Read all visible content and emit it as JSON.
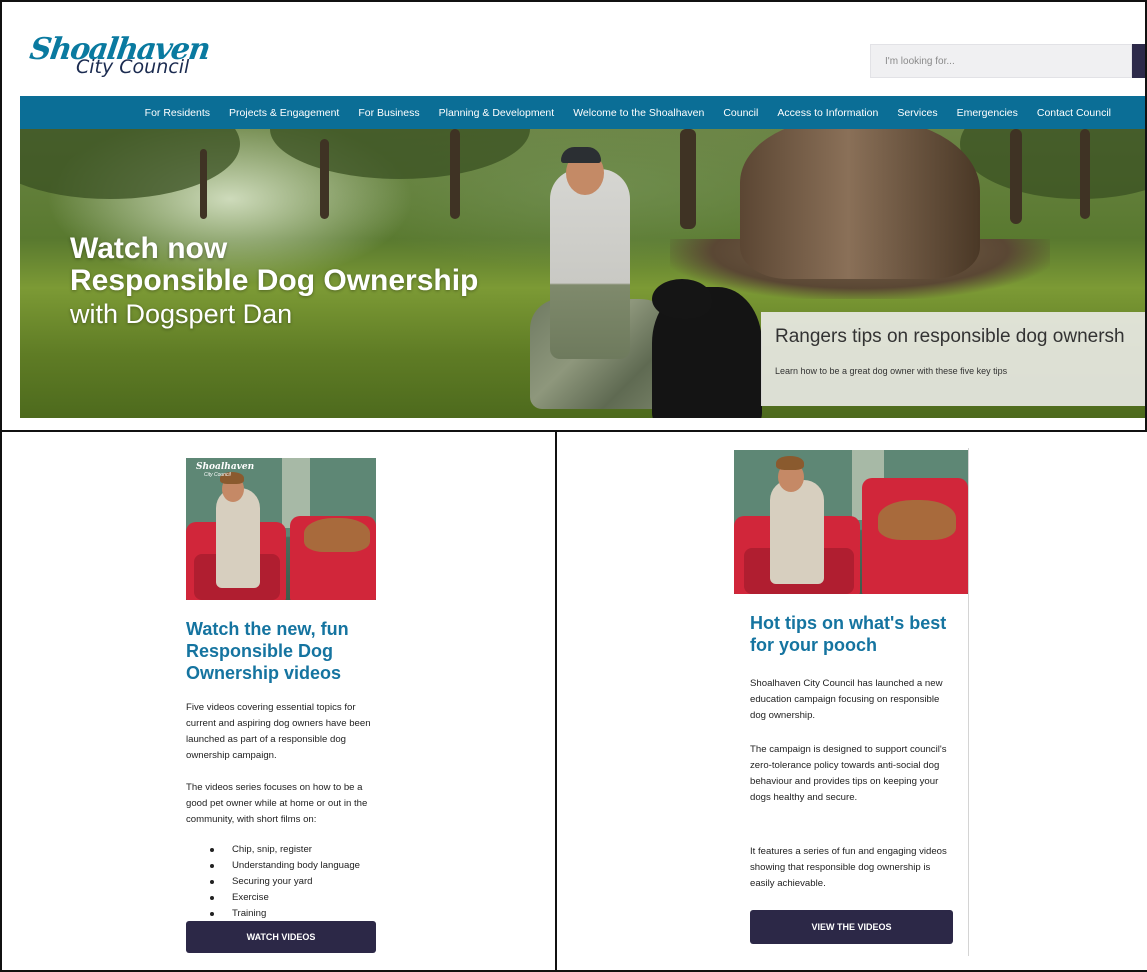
{
  "header": {
    "logo_script": "Shoalhaven",
    "logo_sub": "City Council",
    "search_placeholder": "I'm looking for..."
  },
  "nav": {
    "items": [
      "For Residents",
      "Projects & Engagement",
      "For Business",
      "Planning & Development",
      "Welcome to the Shoalhaven",
      "Council",
      "Access to Information",
      "Services",
      "Emergencies",
      "Contact Council"
    ]
  },
  "hero": {
    "line1": "Watch now",
    "line2": "Responsible Dog Ownership",
    "line3": "with Dogspert Dan",
    "card_title": "Rangers tips on responsible dog ownersh",
    "card_sub": "Learn how to be a great dog owner with these five key tips"
  },
  "left_card": {
    "thumb_logo": "Shoalhaven",
    "thumb_logo_sub": "City Council",
    "title": "Watch the new, fun Responsible Dog Ownership videos",
    "para1": "Five videos covering essential topics for current and aspiring dog owners have been launched as part of a responsible dog ownership campaign.",
    "para2": "The videos series focuses on how to be a good pet owner while at home or out in the community, with short films on:",
    "list": [
      "Chip, snip, register",
      "Understanding body language",
      "Securing your yard",
      "Exercise",
      "Training"
    ],
    "button": "WATCH VIDEOS"
  },
  "right_card": {
    "title": "Hot tips on what's best for your pooch",
    "para1": "Shoalhaven City Council has launched a new education campaign focusing on responsible dog ownership.",
    "para2": "The campaign is designed to support council's zero-tolerance policy towards anti-social dog behaviour and provides tips on keeping your dogs healthy and secure.",
    "para3": "It features a series of fun and engaging videos showing that responsible dog ownership is easily achievable.",
    "button": "VIEW THE VIDEOS"
  },
  "colors": {
    "nav_bg": "#0b6e96",
    "title_blue": "#1574a0",
    "button_bg": "#2c2847"
  }
}
